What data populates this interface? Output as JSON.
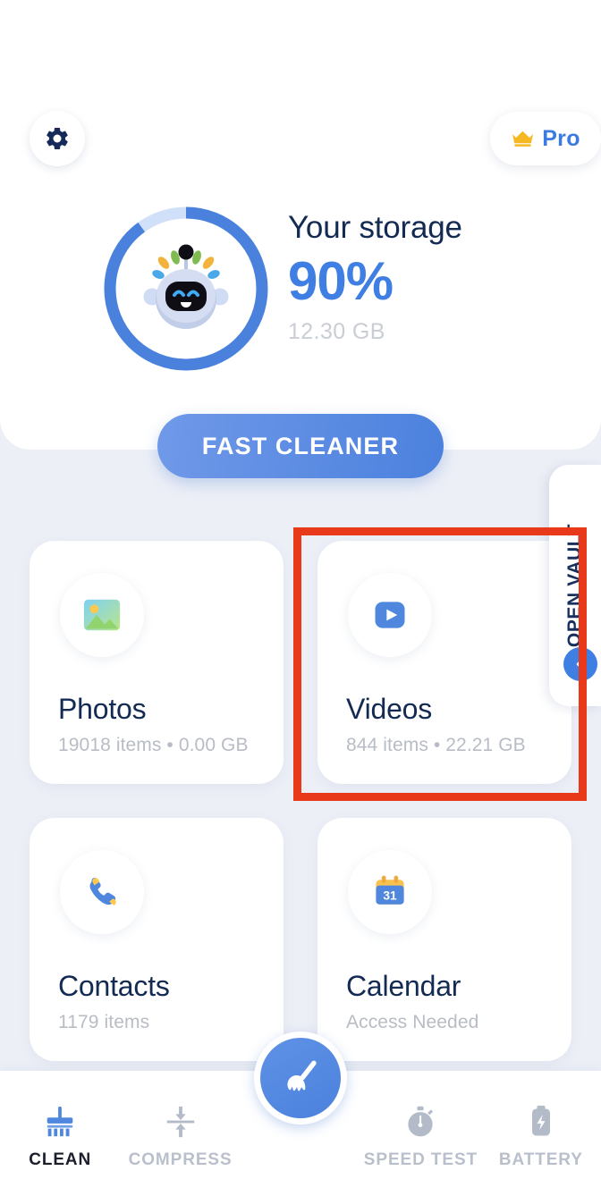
{
  "header": {
    "settings_icon": "gear-icon",
    "pro_badge": {
      "icon": "crown-icon",
      "label": "Pro"
    }
  },
  "storage": {
    "mascot_icon": "robot-mascot-icon",
    "title": "Your storage",
    "percent_label": "90%",
    "percent_value": 90,
    "size_label": "12.30  GB",
    "ring_color": "#4a81dd",
    "ring_track_color": "#cfe0f8",
    "percent_color": "#3f7ee2"
  },
  "fast_cleaner": {
    "label": "FAST CLEANER"
  },
  "vault": {
    "label": "OPEN VAULT",
    "chevron_icon": "chevron-left-icon"
  },
  "tiles": [
    {
      "icon": "photos-image-icon",
      "title": "Photos",
      "subtitle": "19018 items • 0.00 GB"
    },
    {
      "icon": "videos-play-icon",
      "title": "Videos",
      "subtitle": "844 items • 22.21 GB"
    },
    {
      "icon": "contacts-phone-icon",
      "title": "Contacts",
      "subtitle": "1179 items"
    },
    {
      "icon": "calendar-icon",
      "title": "Calendar",
      "subtitle": "Access Needed"
    }
  ],
  "highlight": {
    "color": "#e8391a",
    "target": "Videos"
  },
  "bottom_nav": {
    "items": [
      {
        "label": "CLEAN",
        "icon": "broom-brush-icon",
        "active": true
      },
      {
        "label": "COMPRESS",
        "icon": "compress-arrows-icon",
        "active": false
      },
      {
        "label": "SPEED TEST",
        "icon": "stopwatch-icon",
        "active": false
      },
      {
        "label": "BATTERY",
        "icon": "battery-bolt-icon",
        "active": false
      }
    ],
    "fab": {
      "icon": "broom-icon"
    }
  }
}
